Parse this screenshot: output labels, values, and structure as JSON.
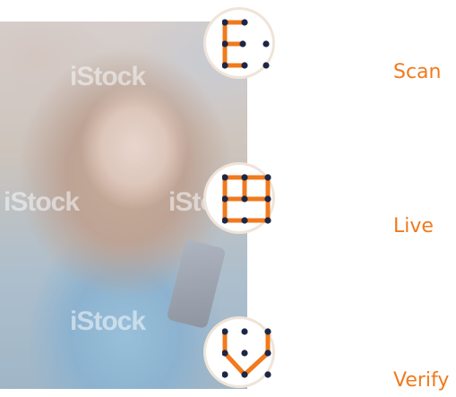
{
  "steps": [
    {
      "label": "Scan",
      "icon": "scan-id-icon"
    },
    {
      "label": "Live",
      "icon": "liveness-grid-icon"
    },
    {
      "label": "Verify",
      "icon": "verify-check-icon"
    }
  ],
  "watermark": {
    "text": "iStock"
  },
  "colors": {
    "accent": "#f07a1d",
    "dot": "#1d2645",
    "ring": "#efe4d9"
  }
}
